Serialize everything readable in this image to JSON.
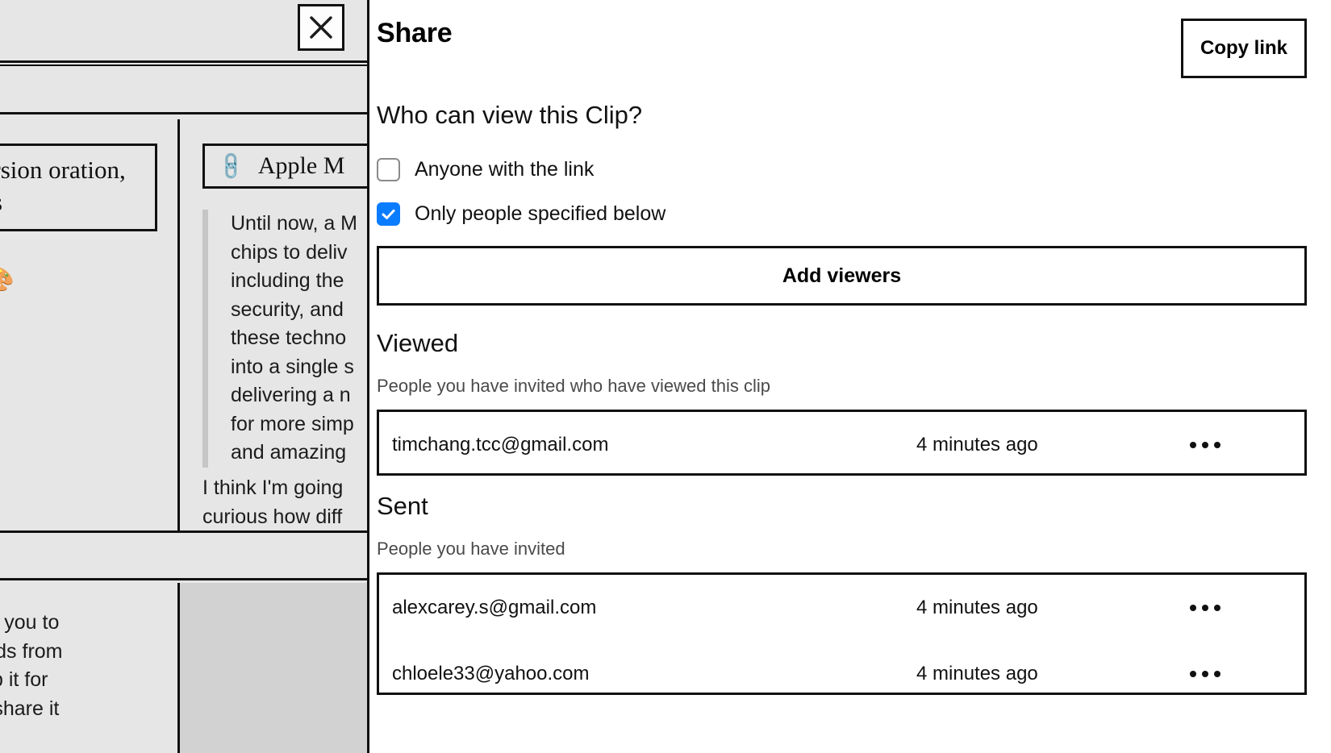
{
  "background_app": {
    "close_icon": "close-icon",
    "card_title": "n Version\noration, &\nms",
    "card_subtitle": "oration. 🎨",
    "link_chip": {
      "icon": "link-icon",
      "label": "Apple M"
    },
    "quote": "Until now, a M\nchips to deliv\nincluding the\nsecurity, and\nthese techno\ninto a single s\ndelivering a n\nfor more simp\nand amazing",
    "paragraph": "I think I'm going\ncurious how diff",
    "bottom_text": "ey allow you to\nsting finds from\nted keep it for\nnds, or share it"
  },
  "share": {
    "title": "Share",
    "copy_link_label": "Copy link",
    "question": "Who can view this Clip?",
    "options": [
      {
        "label": "Anyone with the link",
        "checked": false
      },
      {
        "label": "Only people specified below",
        "checked": true
      }
    ],
    "add_viewers_label": "Add viewers",
    "viewed": {
      "heading": "Viewed",
      "subtitle": "People you have invited who have viewed this clip",
      "rows": [
        {
          "email": "timchang.tcc@gmail.com",
          "time": "4 minutes ago",
          "menu_icon": "more-options-icon"
        }
      ]
    },
    "sent": {
      "heading": "Sent",
      "subtitle": "People you have invited",
      "rows": [
        {
          "email": "alexcarey.s@gmail.com",
          "time": "4 minutes ago",
          "menu_icon": "more-options-icon"
        },
        {
          "email": "chloele33@yahoo.com",
          "time": "4 minutes ago",
          "menu_icon": "more-options-icon"
        }
      ]
    }
  },
  "colors": {
    "accent": "#0a7cff",
    "panel_bg": "#ffffff",
    "app_bg": "#e6e6e6",
    "app_bg_alt": "#d2d2d2",
    "border": "#111111",
    "muted_text": "#4a4a4a"
  }
}
